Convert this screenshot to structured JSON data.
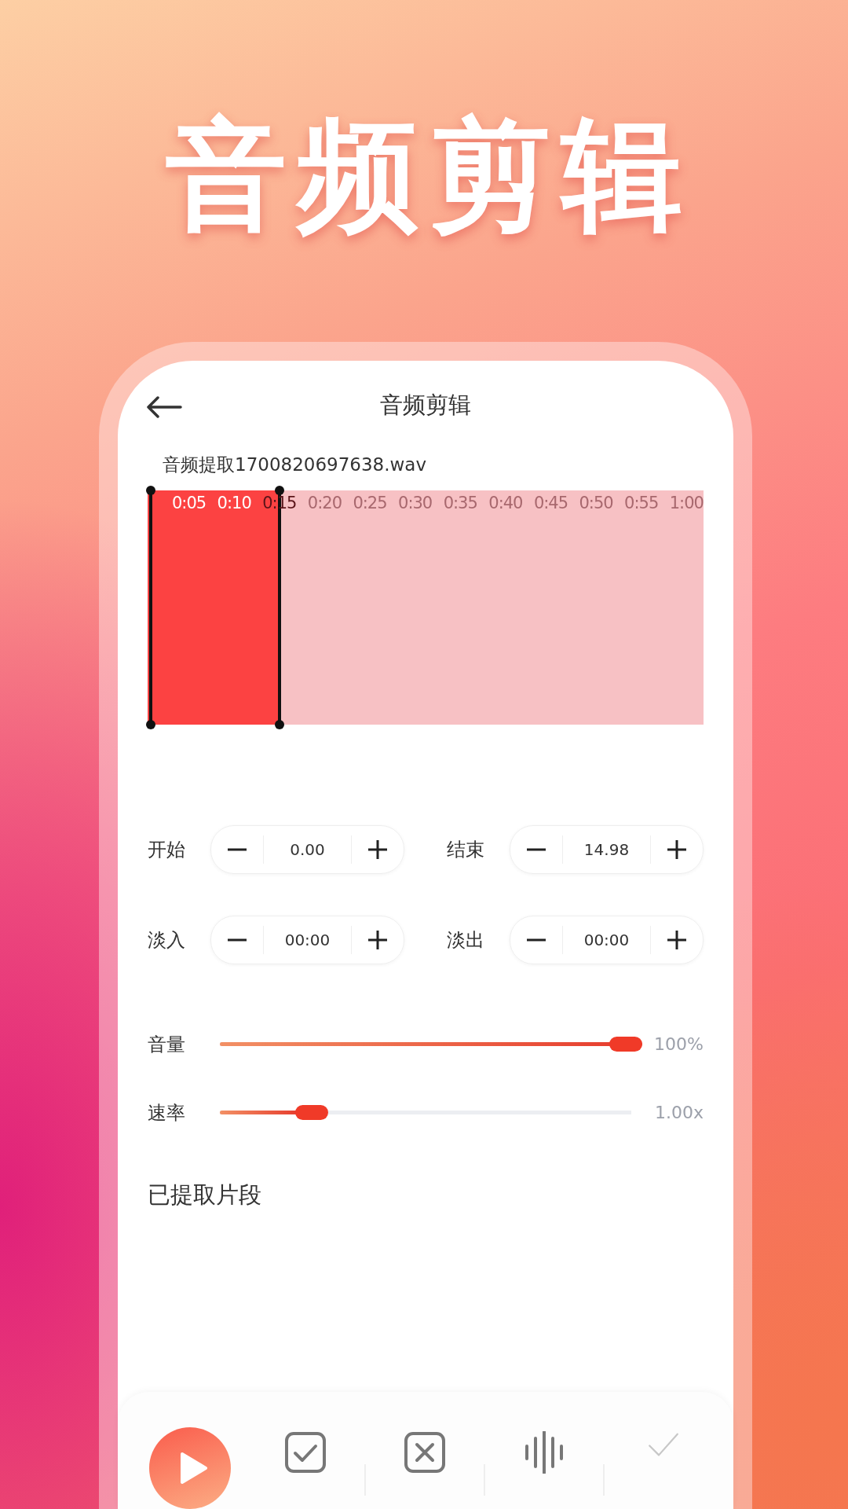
{
  "headline": "音频剪辑",
  "header": {
    "title": "音频剪辑"
  },
  "file_name": "音频提取1700820697638.wav",
  "waveform": {
    "selection": {
      "level": 0.24
    },
    "time_ticks": [
      "0:05",
      "0:10",
      "0:15",
      "0:20",
      "0:25",
      "0:30",
      "0:35",
      "0:40",
      "0:45",
      "0:50",
      "0:55",
      "1:00"
    ]
  },
  "steppers": [
    {
      "label": "开始",
      "value": "0.00"
    },
    {
      "label": "结束",
      "value": "14.98"
    },
    {
      "label": "淡入",
      "value": "00:00"
    },
    {
      "label": "淡出",
      "value": "00:00"
    }
  ],
  "sliders": [
    {
      "label": "音量",
      "level": 1.0,
      "reading": "100%"
    },
    {
      "label": "速率",
      "level": 0.2,
      "reading": "1.00x"
    }
  ],
  "section_title": "已提取片段",
  "toolbar": [
    {
      "kind": "play",
      "disabled": false
    },
    {
      "kind": "check-box",
      "disabled": false
    },
    {
      "kind": "close-box",
      "disabled": false
    },
    {
      "kind": "waveform",
      "disabled": false
    },
    {
      "kind": "check",
      "disabled": true
    }
  ]
}
